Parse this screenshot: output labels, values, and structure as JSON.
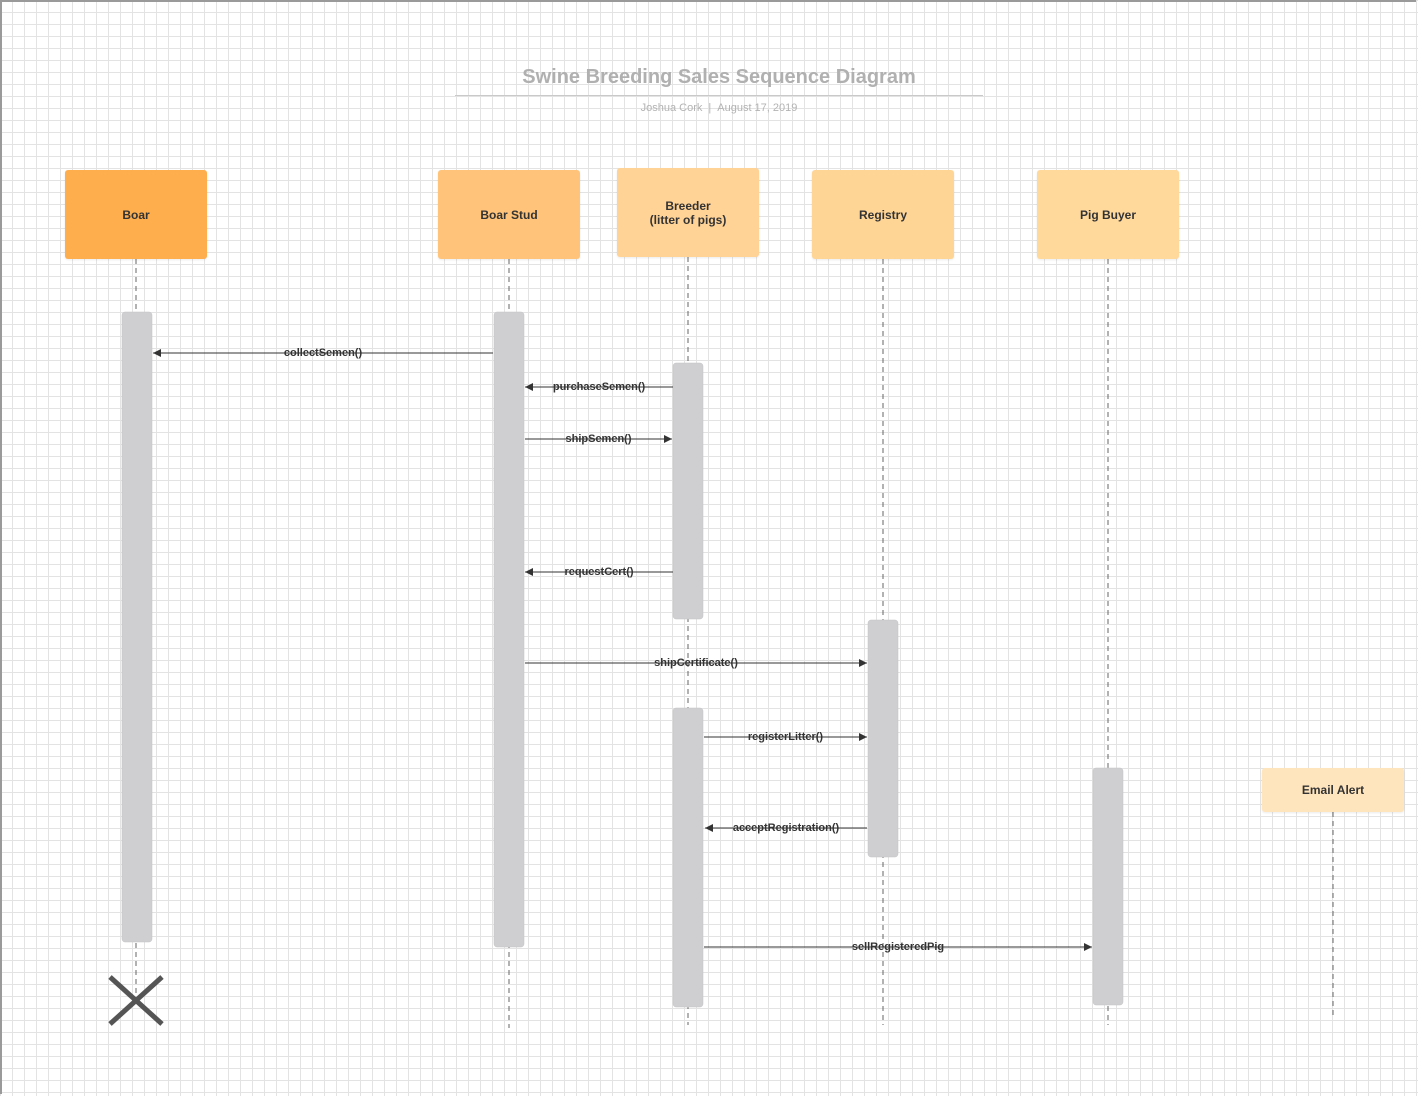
{
  "title": "Swine Breeding Sales Sequence Diagram",
  "author": "Joshua Cork",
  "date": "August 17, 2019",
  "lifelines": [
    {
      "id": "boar",
      "label": "Boar",
      "color": "#FFAE4E"
    },
    {
      "id": "boar-stud",
      "label": "Boar Stud",
      "color": "#FFC47A"
    },
    {
      "id": "breeder",
      "label": "Breeder\n(litter of pigs)",
      "color": "#FFD296"
    },
    {
      "id": "registry",
      "label": "Registry",
      "color": "#FFD596"
    },
    {
      "id": "pig-buyer",
      "label": "Pig Buyer",
      "color": "#FFD89C"
    },
    {
      "id": "email-alert",
      "label": "Email Alert",
      "color": "#FFE5BD"
    }
  ],
  "messages": [
    {
      "label": "collectSemen()",
      "from": "boar-stud",
      "to": "boar"
    },
    {
      "label": "purchaseSemen()",
      "from": "breeder",
      "to": "boar-stud"
    },
    {
      "label": "shipSemen()",
      "from": "boar-stud",
      "to": "breeder"
    },
    {
      "label": "requestCert()",
      "from": "breeder",
      "to": "boar-stud"
    },
    {
      "label": "shipCertificate()",
      "from": "boar-stud",
      "to": "registry"
    },
    {
      "label": "registerLitter()",
      "from": "breeder",
      "to": "registry"
    },
    {
      "label": "acceptRegistration()",
      "from": "registry",
      "to": "breeder"
    },
    {
      "label": "sellRegisteredPig",
      "from": "breeder",
      "to": "pig-buyer"
    }
  ],
  "colors": {
    "activation": "#cfcfd1",
    "lifeline": "#666666",
    "arrow": "#333333",
    "destroy": "#555555"
  }
}
